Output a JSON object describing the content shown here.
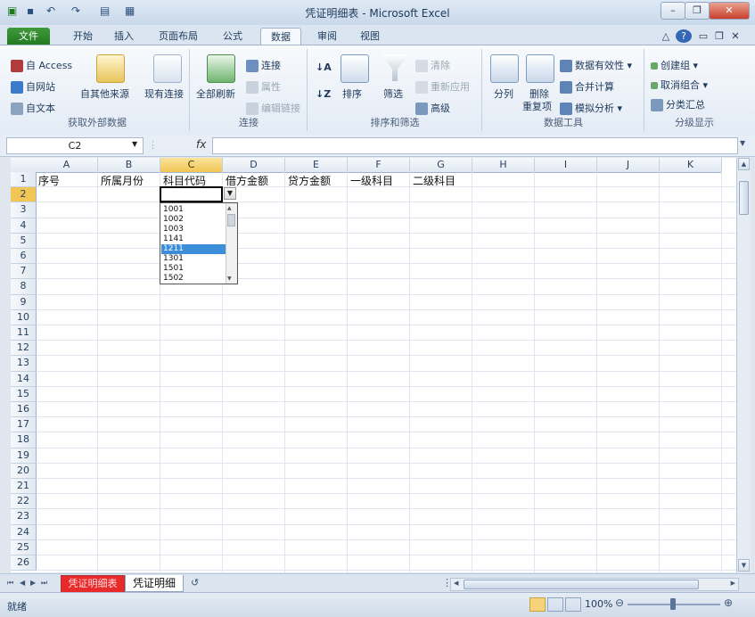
{
  "window": {
    "title": "凭证明细表 - Microsoft Excel",
    "minimize": "–",
    "restore": "❐",
    "close": "✕"
  },
  "ribbon_tabs": [
    "文件",
    "开始",
    "插入",
    "页面布局",
    "公式",
    "数据",
    "审阅",
    "视图"
  ],
  "active_tab": "数据",
  "ribbon": {
    "get_external": {
      "label": "获取外部数据",
      "access": "自 Access",
      "web": "自网站",
      "text": "自文本",
      "other": "自其他来源",
      "existing": "现有连接"
    },
    "connections": {
      "label": "连接",
      "refresh_all": "全部刷新",
      "connections": "连接",
      "properties": "属性",
      "edit_links": "编辑链接"
    },
    "sort_filter": {
      "label": "排序和筛选",
      "sort": "排序",
      "filter": "筛选",
      "clear": "清除",
      "reapply": "重新应用",
      "advanced": "高级"
    },
    "data_tools": {
      "label": "数据工具",
      "text_to_columns": "分列",
      "remove_duplicates_1": "删除",
      "remove_duplicates_2": "重复项",
      "validation": "数据有效性 ▾",
      "consolidate": "合并计算",
      "what_if": "模拟分析 ▾"
    },
    "outline": {
      "label": "分级显示",
      "group": "创建组 ▾",
      "ungroup": "取消组合 ▾",
      "subtotal": "分类汇总"
    }
  },
  "formula_bar": {
    "name_box": "C2",
    "fx": "fx",
    "value": ""
  },
  "columns": [
    "A",
    "B",
    "C",
    "D",
    "E",
    "F",
    "G",
    "H",
    "I",
    "J",
    "K"
  ],
  "rows": [
    "1",
    "2",
    "3",
    "4",
    "5",
    "6",
    "7",
    "8",
    "9",
    "10",
    "11",
    "12",
    "13",
    "14",
    "15",
    "16",
    "17",
    "18",
    "19",
    "20",
    "21",
    "22",
    "23",
    "24",
    "25",
    "26"
  ],
  "header_row": [
    "序号",
    "所属月份",
    "科目代码",
    "借方金额",
    "贷方金额",
    "一级科目",
    "二级科目"
  ],
  "dropdown_options": [
    "1001",
    "1002",
    "1003",
    "1141",
    "1211",
    "1301",
    "1501",
    "1502"
  ],
  "dropdown_selected_index": 4,
  "sheet_tabs": [
    "凭证明细表",
    "凭证明细"
  ],
  "status": {
    "ready": "就绪",
    "zoom": "100%"
  },
  "colors": {
    "file_tab": "#2f8a2d",
    "active_col_header": "#f2c655",
    "dropdown_highlight": "#3b8ed7",
    "sheet1_tab": "#e82a2a"
  }
}
